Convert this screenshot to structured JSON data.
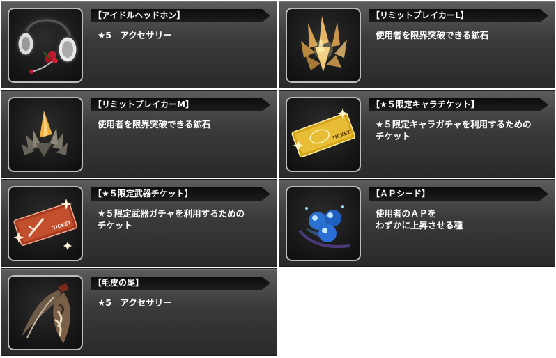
{
  "items": [
    {
      "name": "【アイドルヘッドホン】",
      "desc": "★5　アクセサリー",
      "icon": "headphones-icon"
    },
    {
      "name": "【リミットブレイカーL】",
      "desc": "使用者を限界突破できる鉱石",
      "icon": "crystal-large-icon"
    },
    {
      "name": "【リミットブレイカーM】",
      "desc": "使用者を限界突破できる鉱石",
      "icon": "crystal-medium-icon"
    },
    {
      "name": "【★５限定キャラチケット】",
      "desc": "★５限定キャラガチャを利用するための\nチケット",
      "icon": "gold-ticket-icon",
      "ticket_text": "TICKET"
    },
    {
      "name": "【★５限定武器チケット】",
      "desc": "★５限定武器ガチャを利用するための\nチケット",
      "icon": "red-ticket-icon",
      "ticket_text": "TICKET"
    },
    {
      "name": "【ＡＰシード】",
      "desc": "使用者のＡＰを\nわずかに上昇させる種",
      "icon": "blue-berries-icon"
    },
    {
      "name": "【毛皮の尾】",
      "desc": "★5　アクセサリー",
      "icon": "fur-tail-icon"
    }
  ]
}
